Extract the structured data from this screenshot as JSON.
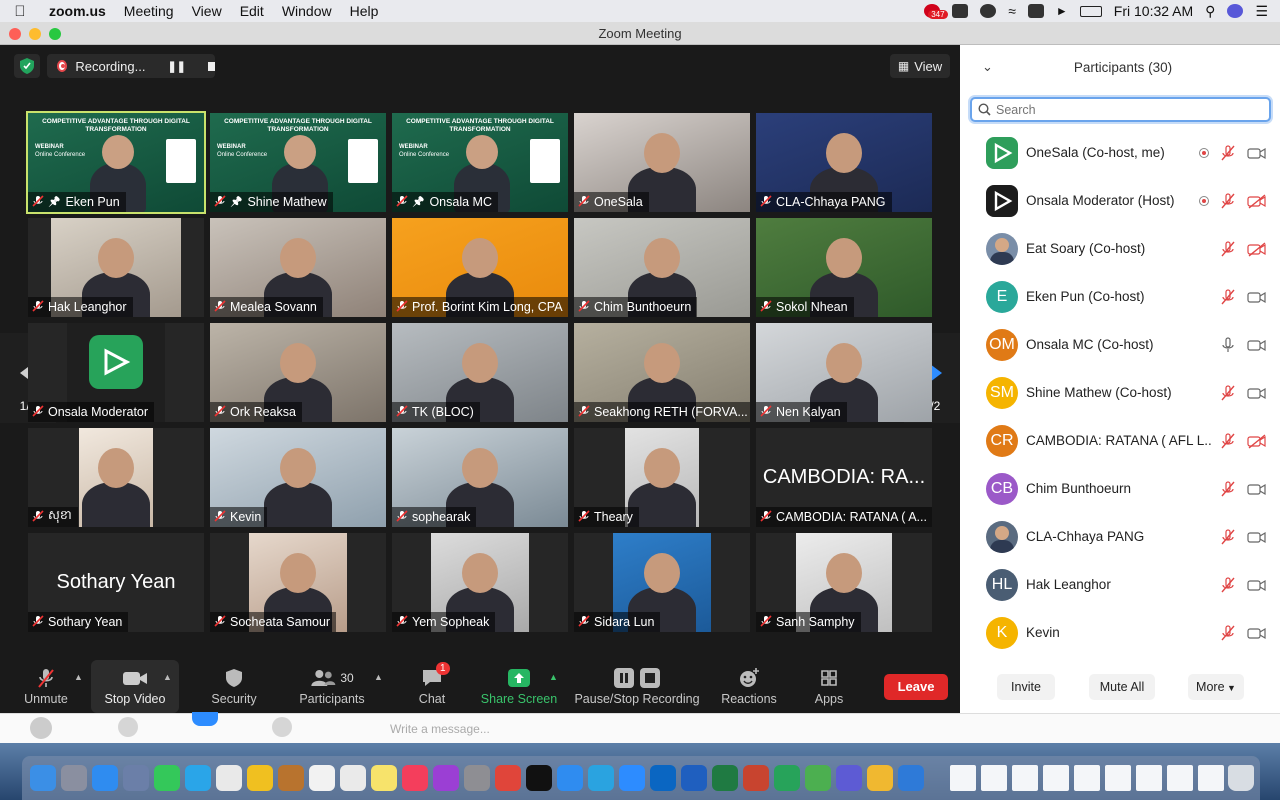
{
  "menubar": {
    "app_name": "zoom.us",
    "items": [
      "Meeting",
      "View",
      "Edit",
      "Window",
      "Help"
    ],
    "notification_badge": "347",
    "clock": "Fri 10:32 AM"
  },
  "window": {
    "title": "Zoom Meeting"
  },
  "meeting": {
    "recording_label": "Recording...",
    "view_label": "View",
    "page_indicator": "1/2",
    "banner": {
      "title": "COMPETITIVE ADVANTAGE THROUGH DIGITAL TRANSFORMATION",
      "webinar": "WEBINAR",
      "subtitle": "Online Conference"
    },
    "tiles": [
      {
        "name": "Eken Pun",
        "kind": "banner",
        "active": true
      },
      {
        "name": "Shine Mathew",
        "kind": "banner"
      },
      {
        "name": "Onsala MC",
        "kind": "banner"
      },
      {
        "name": "OneSala",
        "kind": "video"
      },
      {
        "name": "CLA-Chhaya PANG",
        "kind": "video"
      },
      {
        "name": "Hak Leanghor",
        "kind": "video"
      },
      {
        "name": "Mealea Sovann",
        "kind": "video"
      },
      {
        "name": "Prof. Borint Kim Long, CPA",
        "kind": "video"
      },
      {
        "name": "Chim Bunthoeurn",
        "kind": "video"
      },
      {
        "name": "Sokol Nhean",
        "kind": "video"
      },
      {
        "name": "Onsala Moderator",
        "kind": "logo"
      },
      {
        "name": "Ork Reaksa",
        "kind": "video"
      },
      {
        "name": "TK (BLOC)",
        "kind": "video"
      },
      {
        "name": "Seakhong RETH (FORVA...",
        "kind": "video"
      },
      {
        "name": "Nen Kalyan",
        "kind": "video"
      },
      {
        "name": "សុខា",
        "kind": "video"
      },
      {
        "name": "Kevin",
        "kind": "video"
      },
      {
        "name": "sophearak",
        "kind": "video"
      },
      {
        "name": "Theary",
        "kind": "video"
      },
      {
        "name": "CAMBODIA: RATANA ( A...",
        "kind": "text",
        "big": "CAMBODIA: RA..."
      },
      {
        "name": "Sothary Yean",
        "kind": "text",
        "big": "Sothary Yean"
      },
      {
        "name": "Socheata Samour",
        "kind": "video"
      },
      {
        "name": "Yem Sopheak",
        "kind": "video"
      },
      {
        "name": "Sidara Lun",
        "kind": "video"
      },
      {
        "name": "Sanh Samphy",
        "kind": "video"
      }
    ]
  },
  "toolbar": {
    "unmute": "Unmute",
    "stop_video": "Stop Video",
    "security": "Security",
    "participants": "Participants",
    "participants_count": "30",
    "chat": "Chat",
    "chat_badge": "1",
    "share_screen": "Share Screen",
    "pause_stop": "Pause/Stop Recording",
    "reactions": "Reactions",
    "apps": "Apps",
    "leave": "Leave"
  },
  "panel": {
    "title": "Participants (30)",
    "search_placeholder": "Search",
    "participants": [
      {
        "name": "OneSala (Co-host, me)",
        "initials": "",
        "color": "#2e9e5b",
        "rec": true,
        "mic": "off",
        "video": "on"
      },
      {
        "name": "Onsala Moderator (Host)",
        "initials": "",
        "color": "#1c1c1c",
        "rec": true,
        "mic": "off",
        "video": "off"
      },
      {
        "name": "Eat Soary (Co-host)",
        "initials": "",
        "color": "#7a8ea8",
        "rec": false,
        "mic": "off",
        "video": "off"
      },
      {
        "name": "Eken Pun (Co-host)",
        "initials": "E",
        "color": "#2aa89a",
        "rec": false,
        "mic": "off",
        "video": "on"
      },
      {
        "name": "Onsala MC (Co-host)",
        "initials": "OM",
        "color": "#e07a16",
        "rec": false,
        "mic": "on",
        "video": "on"
      },
      {
        "name": "Shine Mathew (Co-host)",
        "initials": "SM",
        "color": "#f5b400",
        "rec": false,
        "mic": "off",
        "video": "on"
      },
      {
        "name": "CAMBODIA: RATANA ( AFL L...",
        "initials": "CR",
        "color": "#e07a16",
        "rec": false,
        "mic": "off",
        "video": "off"
      },
      {
        "name": "Chim Bunthoeurn",
        "initials": "CB",
        "color": "#9b59c8",
        "rec": false,
        "mic": "off",
        "video": "on"
      },
      {
        "name": "CLA-Chhaya PANG",
        "initials": "",
        "color": "#5a6b80",
        "rec": false,
        "mic": "off",
        "video": "on"
      },
      {
        "name": "Hak Leanghor",
        "initials": "HL",
        "color": "#4a5d73",
        "rec": false,
        "mic": "off",
        "video": "on"
      },
      {
        "name": "Kevin",
        "initials": "K",
        "color": "#f5b400",
        "rec": false,
        "mic": "off",
        "video": "on"
      }
    ],
    "invite": "Invite",
    "mute_all": "Mute All",
    "more": "More"
  },
  "chat_placeholder": "Write a message..."
}
